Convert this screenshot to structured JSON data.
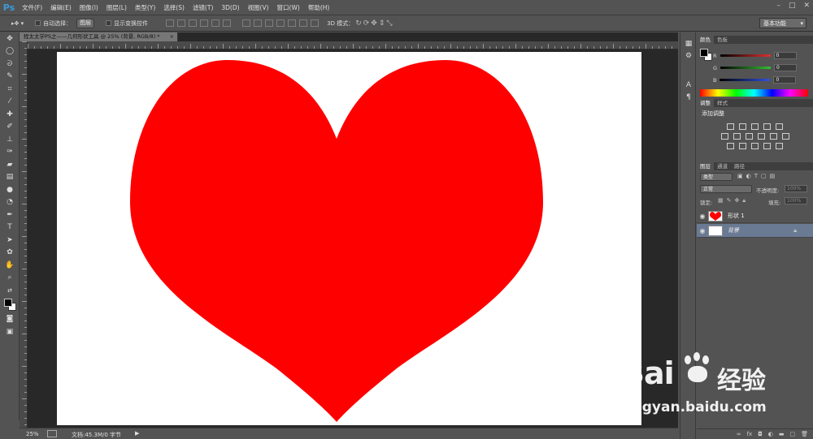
{
  "app": {
    "logo": "Ps"
  },
  "menu": [
    "文件(F)",
    "编辑(E)",
    "图像(I)",
    "图层(L)",
    "类型(Y)",
    "选择(S)",
    "滤镜(T)",
    "3D(D)",
    "视图(V)",
    "窗口(W)",
    "帮助(H)"
  ],
  "window_controls": [
    "–",
    "□",
    "✕"
  ],
  "options": {
    "auto_select_label": "自动选择：",
    "auto_select_value": "图层",
    "show_transform_label": "显示变换控件",
    "mode_3d_label": "3D 模式：",
    "workspace": "基本功能"
  },
  "document": {
    "tab_title": "程太太学PS之——几何形状工具 @ 25% (背景, RGB/8) *",
    "tab_close": "×",
    "heart_color": "#ff0000"
  },
  "status": {
    "zoom": "25%",
    "doc_info": "文档:45.3M/0 字节"
  },
  "color_panel": {
    "tabs": [
      "颜色",
      "色板"
    ],
    "channels": [
      {
        "label": "R",
        "value": "0",
        "color": "#e03030"
      },
      {
        "label": "G",
        "value": "0",
        "color": "#30c030"
      },
      {
        "label": "B",
        "value": "0",
        "color": "#3050e0"
      }
    ]
  },
  "adjust_panel": {
    "tabs": [
      "调整",
      "样式"
    ],
    "title": "添加调整"
  },
  "layers_panel": {
    "tabs": [
      "图层",
      "通道",
      "路径"
    ],
    "filter_kind": "类型",
    "blend_mode": "正常",
    "opacity_label": "不透明度:",
    "opacity_value": "100%",
    "lock_label": "锁定:",
    "fill_label": "填充:",
    "fill_value": "100%",
    "layers": [
      {
        "name": "形状 1",
        "selected": false
      },
      {
        "name": "背景",
        "selected": true
      }
    ],
    "footer_icons": [
      "link-icon",
      "fx-icon",
      "mask-icon",
      "adjustment-icon",
      "group-icon",
      "new-layer-icon",
      "trash-icon"
    ]
  },
  "watermark": {
    "brand_text": "Bai",
    "brand_cn": "经验",
    "url": "jingyan.baidu.com"
  }
}
